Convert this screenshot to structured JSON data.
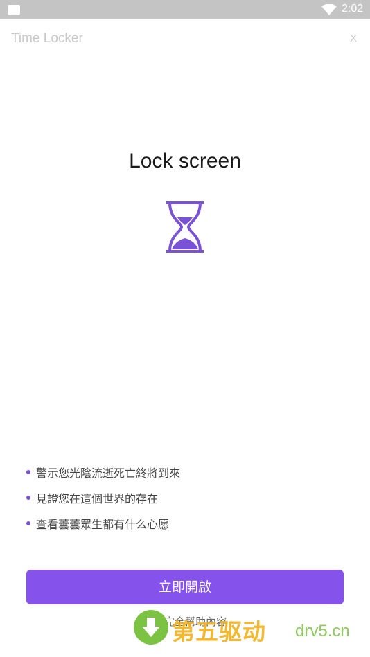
{
  "status_bar": {
    "time": "2:02"
  },
  "header": {
    "app_title": "Time Locker",
    "close_label": "X"
  },
  "main": {
    "title": "Lock screen",
    "features": [
      "警示您光陰流逝死亡終將到來",
      "見證您在這個世界的存在",
      "查看蕓蕓眾生都有什么心愿"
    ],
    "enable_button_label": "立即開啟",
    "help_link": "查看完全幫助內容"
  },
  "watermark": {
    "text_cn": "第五驱动",
    "text_en": "drv5.cn"
  },
  "colors": {
    "accent": "#8553ec",
    "status_bar": "#c4c4c4",
    "watermark_green": "#7cc243",
    "watermark_orange": "#f2b01a"
  }
}
